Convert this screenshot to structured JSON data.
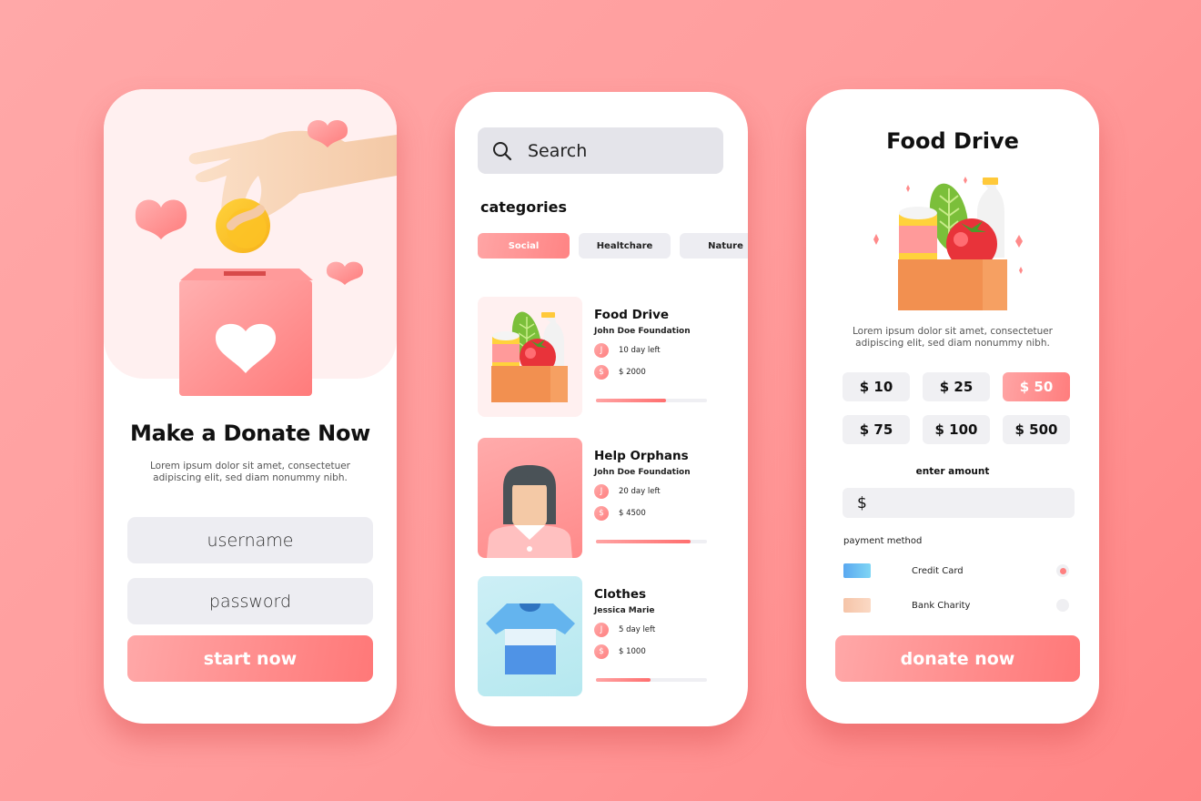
{
  "login": {
    "title": "Make a Donate Now",
    "description": "Lorem ipsum dolor sit amet, consectetuer adipiscing elit, sed diam nonummy nibh.",
    "username_placeholder": "username",
    "password_placeholder": "password",
    "start_label": "start now"
  },
  "browse": {
    "search_placeholder": "Search",
    "categories_title": "categories",
    "categories": [
      {
        "label": "Social",
        "active": true
      },
      {
        "label": "Healtchare",
        "active": false
      },
      {
        "label": "Nature",
        "active": false
      }
    ],
    "campaigns": [
      {
        "title": "Food Drive",
        "org": "John Doe Foundation",
        "days_left": "10 day left",
        "amount": "$ 2000",
        "progress": 0.63,
        "time_icon": "clock-icon",
        "money_icon": "dollar-icon"
      },
      {
        "title": "Help Orphans",
        "org": "John Doe Foundation",
        "days_left": "20 day left",
        "amount": "$ 4500",
        "progress": 0.85,
        "time_icon": "clock-icon",
        "money_icon": "dollar-icon"
      },
      {
        "title": "Clothes",
        "org": "Jessica Marie",
        "days_left": "5 day left",
        "amount": "$ 1000",
        "progress": 0.49,
        "time_icon": "clock-icon",
        "money_icon": "dollar-icon"
      }
    ]
  },
  "detail": {
    "title": "Food Drive",
    "description": "Lorem ipsum dolor sit amet, consectetuer adipiscing elit, sed diam nonummy nibh.",
    "amounts": [
      {
        "label": "$ 10",
        "active": false
      },
      {
        "label": "$ 25",
        "active": false
      },
      {
        "label": "$ 50",
        "active": true
      },
      {
        "label": "$ 75",
        "active": false
      },
      {
        "label": "$ 100",
        "active": false
      },
      {
        "label": "$ 500",
        "active": false
      }
    ],
    "enter_amount_label": "enter amount",
    "currency_symbol": "$",
    "amount_value": "",
    "payment_label": "payment method",
    "payment_methods": [
      {
        "label": "Credit Card",
        "selected": true,
        "swatch_from": "#5aa8f0",
        "swatch_to": "#7fd6f5"
      },
      {
        "label": "Bank Charity",
        "selected": false,
        "swatch_from": "#f5c4a8",
        "swatch_to": "#fbd9c4"
      }
    ],
    "donate_label": "donate now"
  },
  "colors": {
    "accent": "#ff8585",
    "accent_light": "#ffa8a8",
    "field_bg": "#ededf2"
  },
  "icons": {
    "time": "J",
    "money": "$"
  }
}
